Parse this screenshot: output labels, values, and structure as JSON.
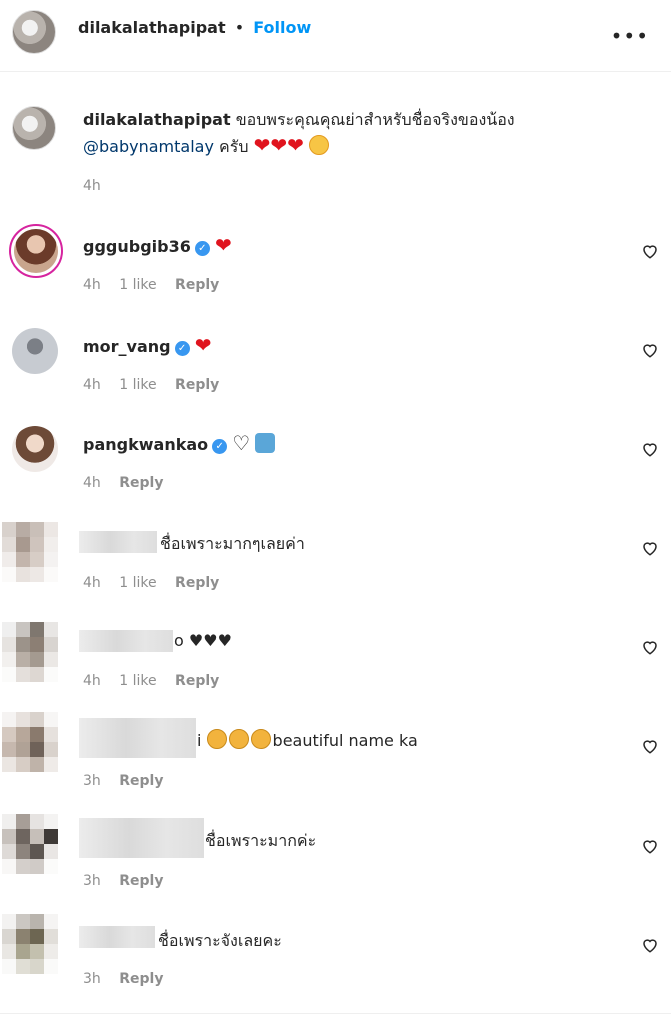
{
  "header": {
    "username": "dilakalathapipat",
    "separator": "•",
    "follow_label": "Follow",
    "more_label": "•••"
  },
  "caption": {
    "username": "dilakalathapipat",
    "text": "ขอบพระคุณคุณย่าสำหรับชื่อจริงของน้อง",
    "mention": "@babynamtalay",
    "text2": "ครับ",
    "emojis": [
      "red-heart",
      "red-heart",
      "red-heart",
      "smiling-face-with-hearts"
    ],
    "time": "4h"
  },
  "comments": [
    {
      "username": "gggubgib36",
      "verified": true,
      "text": "❤",
      "time": "4h",
      "likes": "1 like",
      "reply": "Reply"
    },
    {
      "username": "mor_vang",
      "verified": true,
      "text": "❤",
      "time": "4h",
      "likes": "1 like",
      "reply": "Reply"
    },
    {
      "username": "pangkwankao",
      "verified": true,
      "text": "♡",
      "time": "4h",
      "likes": "",
      "reply": "Reply"
    },
    {
      "username": "",
      "text": "ชื่อเพราะมากๆเลยค่า",
      "time": "4h",
      "likes": "1 like",
      "reply": "Reply"
    },
    {
      "username": "",
      "text": "o ♥♥♥",
      "time": "4h",
      "likes": "1 like",
      "reply": "Reply"
    },
    {
      "username": "",
      "text": "beautiful name ka",
      "prefix": "i",
      "time": "3h",
      "likes": "",
      "reply": "Reply"
    },
    {
      "username": "",
      "text": "ชื่อเพราะมากค่ะ",
      "time": "3h",
      "likes": "",
      "reply": "Reply"
    },
    {
      "username": "",
      "text": "ชื่อเพราะจังเลยคะ",
      "time": "3h",
      "likes": "",
      "reply": "Reply"
    }
  ],
  "colors": {
    "accent": "#0095f6",
    "verified": "#3897f0",
    "heart": "#e0141e",
    "muted": "#8e8e8e"
  },
  "icons": [
    "heart-outline-icon",
    "verified-icon",
    "more-icon"
  ]
}
